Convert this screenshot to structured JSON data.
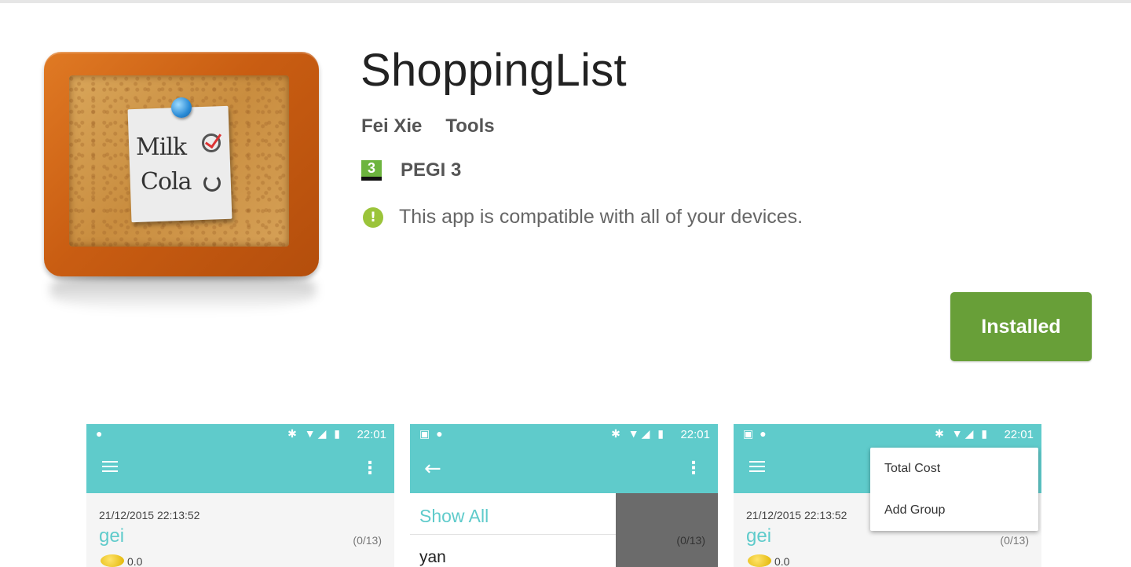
{
  "app": {
    "title": "ShoppingList",
    "developer": "Fei Xie",
    "category": "Tools",
    "rating_badge": "3",
    "rating_label": "PEGI 3",
    "compatibility": "This app is compatible with all of your devices.",
    "install_label": "Installed",
    "icon_note": {
      "line1": "Milk",
      "line2": "Cola"
    }
  },
  "colors": {
    "install_button": "#689f38",
    "toolbar": "#5fcbcb",
    "info_icon": "#9bc43a",
    "pegi": "#6db43f"
  },
  "screenshots": [
    {
      "status_time": "22:01",
      "list": {
        "date": "21/12/2015 22:13:52",
        "name": "gei",
        "count": "(0/13)",
        "cost": "0.0"
      }
    },
    {
      "status_time": "22:01",
      "drawer": {
        "show_all": "Show All",
        "item": "yan"
      },
      "count": "(0/13)"
    },
    {
      "status_time": "22:01",
      "menu": [
        "Total Cost",
        "Add Group"
      ],
      "list": {
        "date": "21/12/2015 22:13:52",
        "name": "gei",
        "count": "(0/13)",
        "cost": "0.0"
      }
    }
  ]
}
